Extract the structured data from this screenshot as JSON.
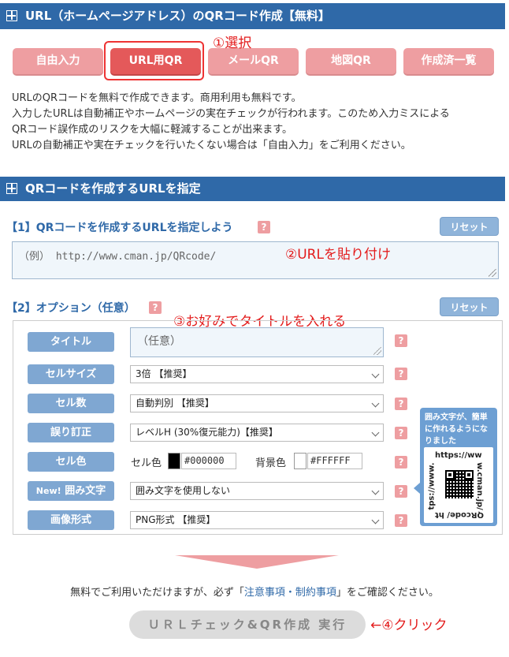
{
  "header1": {
    "title": "URL（ホームページアドレス）のQRコード作成【無料】"
  },
  "tabs": [
    {
      "label": "自由入力"
    },
    {
      "label": "URL用QR"
    },
    {
      "label": "メールQR"
    },
    {
      "label": "地図QR"
    },
    {
      "label": "作成済一覧"
    }
  ],
  "annotations": {
    "step1": "①選択",
    "step2": "②URLを貼り付け",
    "step3": "③お好みでタイトルを入れる",
    "step4": "←④クリック"
  },
  "description": [
    "URLのQRコードを無料で作成できます。商用利用も無料です。",
    "入力したURLは自動補正やホームページの実在チェックが行われます。このため入力ミスによる",
    "QRコード誤作成のリスクを大幅に軽減することが出来ます。",
    "URLの自動補正や実在チェックを行いたくない場合は「自由入力」をご利用ください。"
  ],
  "header2": {
    "title": "QRコードを作成するURLを指定"
  },
  "section1": {
    "title": "【1】QRコードを作成するURLを指定しよう",
    "help": "?",
    "reset": "リセット",
    "url_placeholder": "（例） http://www.cman.jp/QRcode/"
  },
  "section2": {
    "title": "【2】オプション（任意）",
    "help": "?",
    "reset": "リセット"
  },
  "options": {
    "title_label": "タイトル",
    "title_placeholder": "（任意）",
    "cellsize_label": "セルサイズ",
    "cellsize_value": "3倍 【推奨】",
    "cellcount_label": "セル数",
    "cellcount_value": "自動判別 【推奨】",
    "ecc_label": "誤り訂正",
    "ecc_value": "レベルH (30%復元能力)【推奨】",
    "color_label": "セル色",
    "cell_color_text": "セル色",
    "cell_color_hex": "#000000",
    "bg_color_text": "背景色",
    "bg_color_hex": "#FFFFFF",
    "frame_new": "New!",
    "frame_label": "囲み文字",
    "frame_value": "囲み文字を使用しない",
    "format_label": "画像形式",
    "format_value": "PNG形式 【推奨】",
    "help": "?"
  },
  "bubble": {
    "text": "囲み文字が、簡単に作れるようになりました",
    "sample_top": "https://ww",
    "sample_right": "w.cman.jp/",
    "sample_bottom": "QRcode/ ht",
    "sample_left": "tps://www."
  },
  "notice": {
    "prefix": "無料でご利用いただけますが、必ず「",
    "link": "注意事項・制約事項",
    "suffix": "」をご確認ください。"
  },
  "run_button": "ＵＲＬチェック&QR作成 実行",
  "colors": {
    "primary": "#2f69a8",
    "tab": "#ee9ea1",
    "tab_active": "#e4595a",
    "annotation": "#e31c1c"
  }
}
